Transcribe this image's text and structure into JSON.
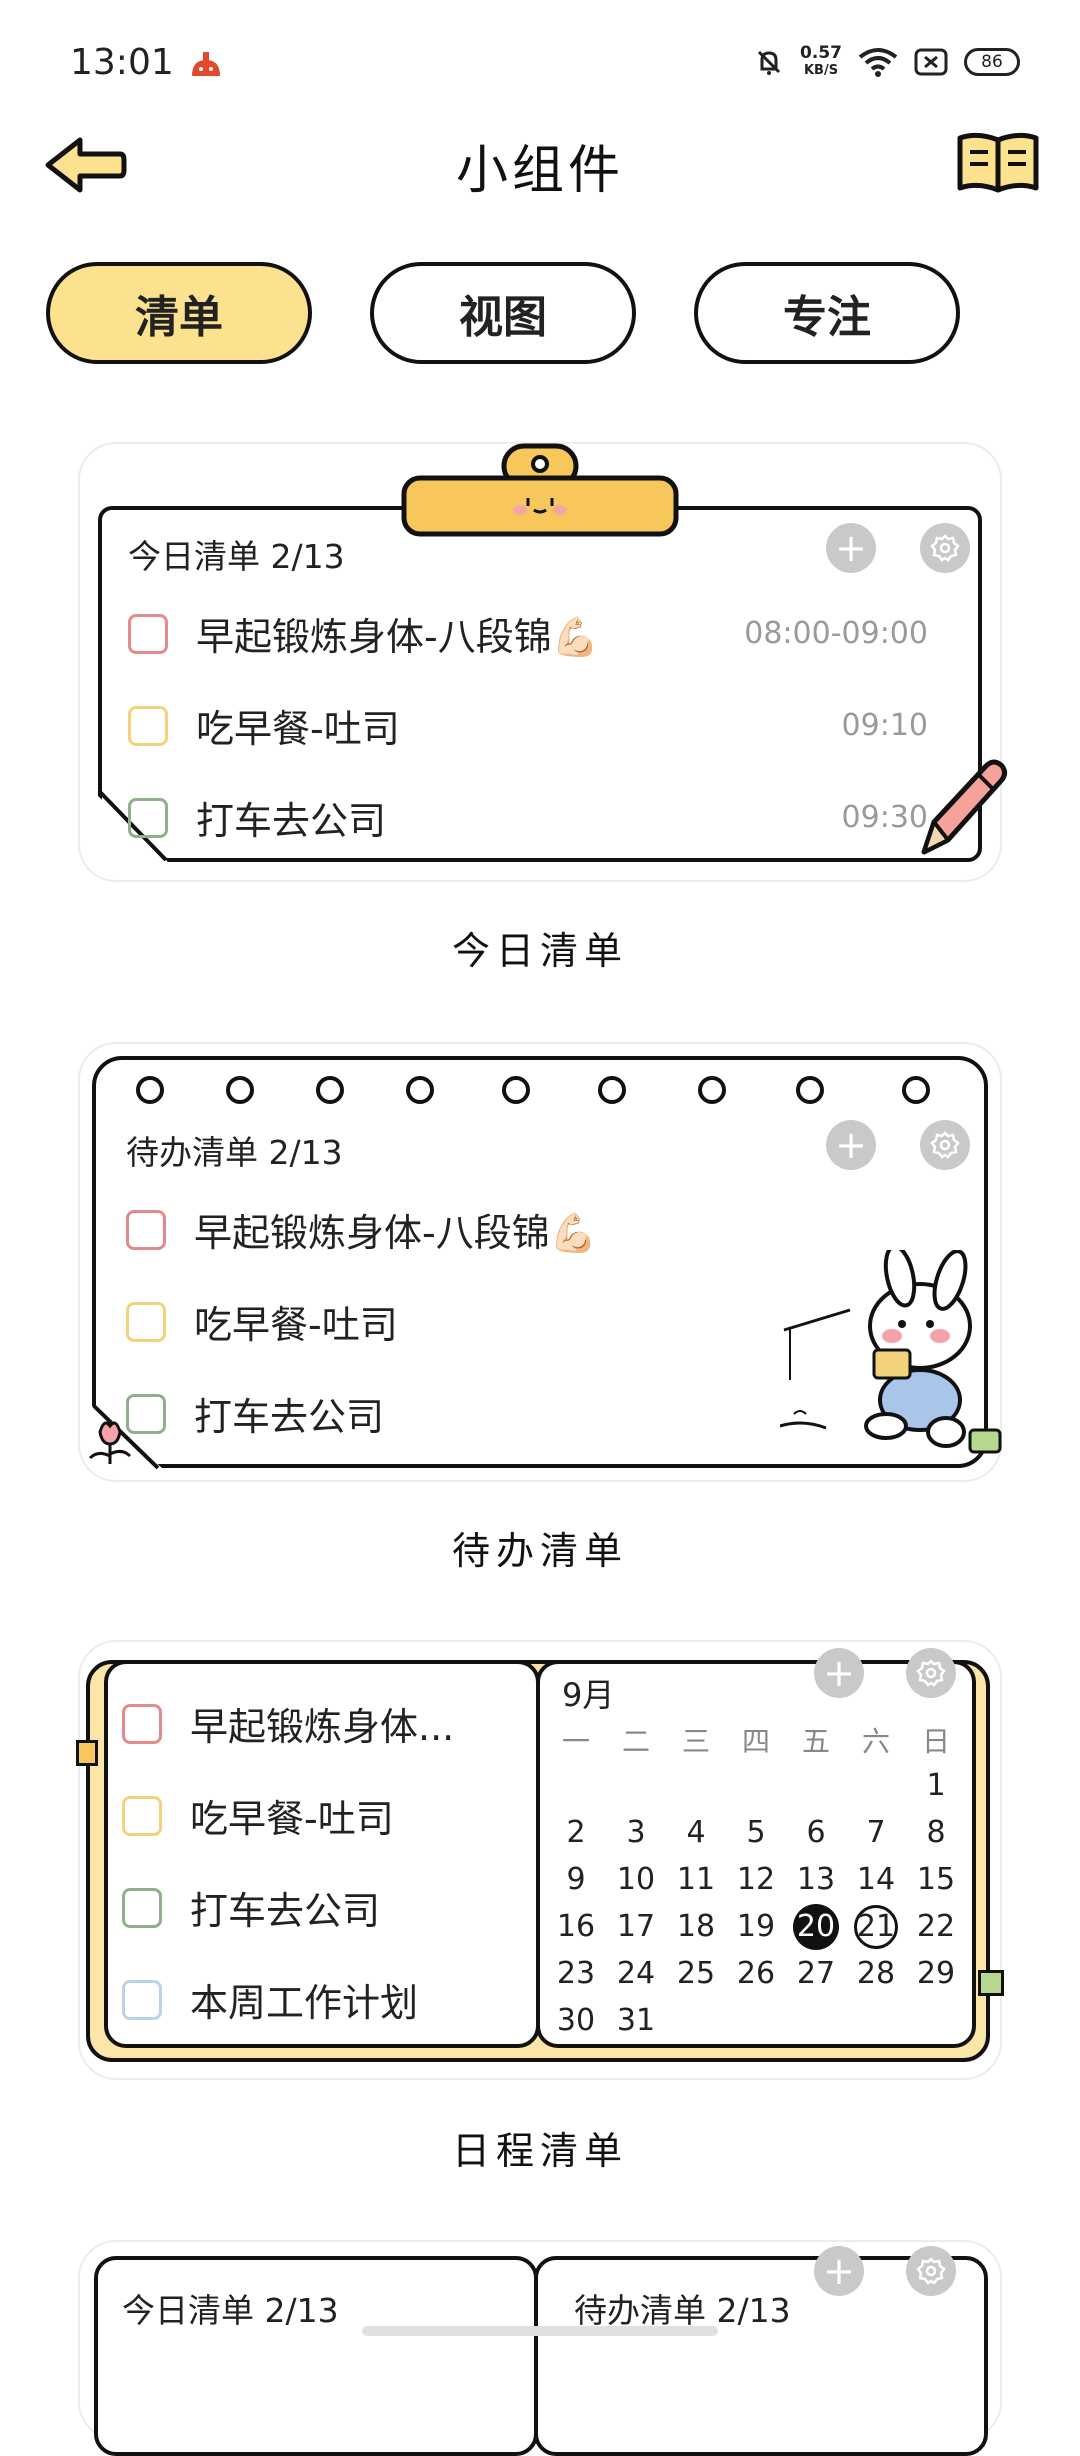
{
  "status_bar": {
    "time": "13:01",
    "speed_value": "0.57",
    "speed_unit": "KB/S",
    "battery": "86"
  },
  "header": {
    "title": "小组件",
    "back_icon": "back-arrow-icon",
    "book_icon": "open-book-icon"
  },
  "tabs": [
    {
      "label": "清单",
      "active": true
    },
    {
      "label": "视图",
      "active": false
    },
    {
      "label": "专注",
      "active": false
    }
  ],
  "widgets": {
    "today": {
      "heading": "今日清单 2/13",
      "caption": "今日清单",
      "tasks": [
        {
          "title": "早起锻炼身体-八段锦💪🏻",
          "time": "08:00-09:00",
          "color": "#e58a8a"
        },
        {
          "title": "吃早餐-吐司",
          "time": "09:10",
          "color": "#f2d27a"
        },
        {
          "title": "打车去公司",
          "time": "09:30",
          "color": "#8fb08a"
        }
      ]
    },
    "todo": {
      "heading": "待办清单 2/13",
      "caption": "待办清单",
      "tasks": [
        {
          "title": "早起锻炼身体-八段锦💪🏻",
          "color": "#e58a8a"
        },
        {
          "title": "吃早餐-吐司",
          "color": "#f2d27a"
        },
        {
          "title": "打车去公司",
          "color": "#8fb08a"
        }
      ]
    },
    "schedule": {
      "caption": "日程清单",
      "tasks": [
        {
          "title": "早起锻炼身体...",
          "color": "#e58a8a"
        },
        {
          "title": "吃早餐-吐司",
          "color": "#f2d27a"
        },
        {
          "title": "打车去公司",
          "color": "#8fb08a"
        },
        {
          "title": "本周工作计划",
          "color": "#b9d4ea"
        }
      ],
      "calendar": {
        "month": "9月",
        "weekdays": [
          "一",
          "二",
          "三",
          "四",
          "五",
          "六",
          "日"
        ],
        "first_weekday_index": 6,
        "days": 31,
        "today": 20,
        "selected": 21
      }
    },
    "combo": {
      "left_heading": "今日清单 2/13",
      "right_heading": "待办清单 2/13"
    }
  },
  "colors": {
    "accent_yellow": "#fce28e",
    "button_gray": "#c9c9c9"
  }
}
